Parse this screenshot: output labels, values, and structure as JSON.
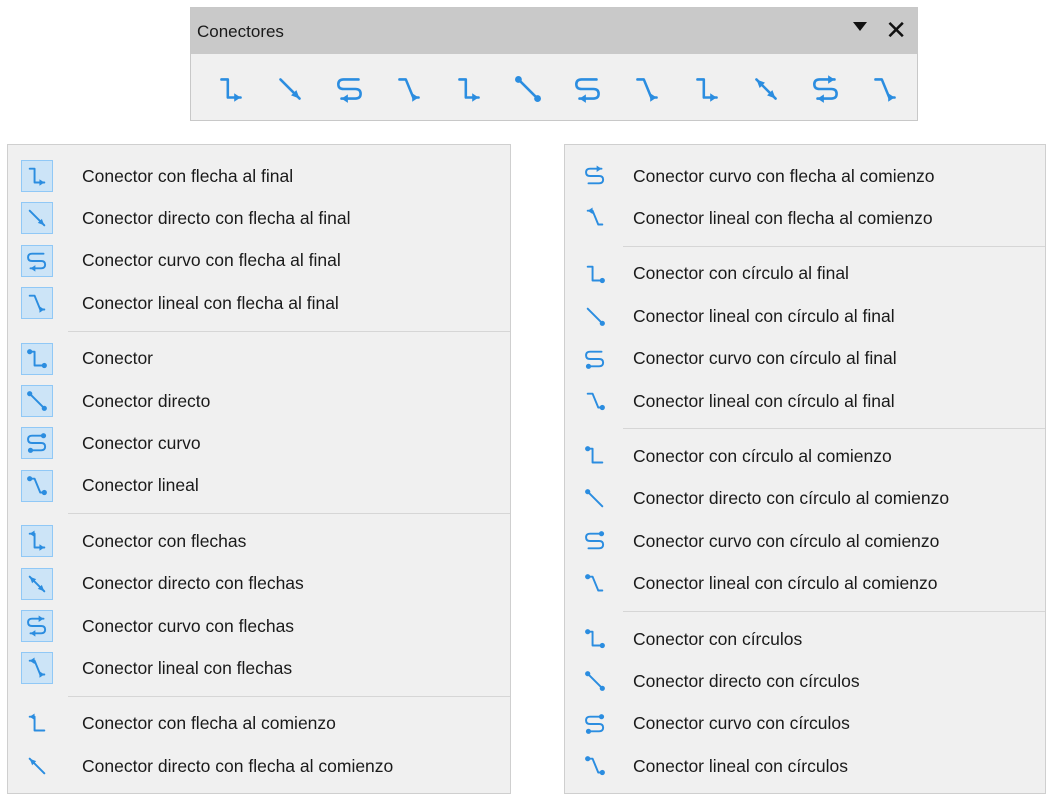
{
  "toolbar": {
    "title": "Conectores",
    "icons": [
      "connector-ends-arrow-icon",
      "straight-connector-ends-arrow-icon",
      "curved-connector-ends-arrow-icon",
      "line-connector-ends-arrow-icon",
      "connector-icon",
      "straight-connector-icon",
      "curved-connector-icon",
      "line-connector-icon",
      "connector-ends-arrow-icon",
      "straight-connector-arrows-icon",
      "curved-connector-arrows-icon",
      "line-connector-arrows-icon"
    ]
  },
  "left_menu": {
    "groups": [
      [
        {
          "label": "Conector con flecha al final",
          "icon": "elbow",
          "ends": "end-arrow",
          "checked": true
        },
        {
          "label": "Conector directo con flecha al final",
          "icon": "straight",
          "ends": "end-arrow",
          "checked": true
        },
        {
          "label": "Conector curvo con flecha al final",
          "icon": "curved",
          "ends": "end-arrow",
          "checked": true
        },
        {
          "label": "Conector lineal con flecha al final",
          "icon": "lineal",
          "ends": "end-arrow",
          "checked": true
        }
      ],
      [
        {
          "label": "Conector",
          "icon": "elbow",
          "ends": "plain",
          "checked": true
        },
        {
          "label": "Conector directo",
          "icon": "straight",
          "ends": "plain",
          "checked": true
        },
        {
          "label": "Conector curvo",
          "icon": "curved",
          "ends": "plain",
          "checked": true
        },
        {
          "label": "Conector lineal",
          "icon": "lineal",
          "ends": "plain",
          "checked": true
        }
      ],
      [
        {
          "label": "Conector con flechas",
          "icon": "elbow",
          "ends": "arrows",
          "checked": true
        },
        {
          "label": "Conector directo con flechas",
          "icon": "straight",
          "ends": "arrows",
          "checked": true
        },
        {
          "label": "Conector curvo con flechas",
          "icon": "curved",
          "ends": "arrows",
          "checked": true
        },
        {
          "label": "Conector lineal con flechas",
          "icon": "lineal",
          "ends": "arrows",
          "checked": true
        }
      ],
      [
        {
          "label": "Conector con flecha al comienzo",
          "icon": "elbow",
          "ends": "start-arrow",
          "checked": false
        },
        {
          "label": "Conector directo con flecha al comienzo",
          "icon": "straight",
          "ends": "start-arrow",
          "checked": false
        }
      ]
    ]
  },
  "right_menu": {
    "groups": [
      [
        {
          "label": "Conector curvo con flecha al comienzo",
          "icon": "curved",
          "ends": "start-arrow",
          "checked": false
        },
        {
          "label": "Conector lineal con flecha al comienzo",
          "icon": "lineal",
          "ends": "start-arrow",
          "checked": false
        }
      ],
      [
        {
          "label": "Conector con círculo al final",
          "icon": "elbow",
          "ends": "end-circle",
          "checked": false
        },
        {
          "label": "Conector lineal con círculo al final",
          "icon": "straight",
          "ends": "end-circle",
          "checked": false
        },
        {
          "label": "Conector curvo con círculo al final",
          "icon": "curved",
          "ends": "end-circle",
          "checked": false
        },
        {
          "label": "Conector lineal con círculo al final",
          "icon": "lineal",
          "ends": "end-circle",
          "checked": false
        }
      ],
      [
        {
          "label": "Conector con círculo al comienzo",
          "icon": "elbow",
          "ends": "start-circle",
          "checked": false
        },
        {
          "label": "Conector directo con círculo al comienzo",
          "icon": "straight",
          "ends": "start-circle",
          "checked": false
        },
        {
          "label": "Conector curvo con círculo al comienzo",
          "icon": "curved",
          "ends": "start-circle",
          "checked": false
        },
        {
          "label": "Conector lineal con círculo al comienzo",
          "icon": "lineal",
          "ends": "start-circle",
          "checked": false
        }
      ],
      [
        {
          "label": "Conector con círculos",
          "icon": "elbow",
          "ends": "circles",
          "checked": false
        },
        {
          "label": "Conector directo con círculos",
          "icon": "straight",
          "ends": "circles",
          "checked": false
        },
        {
          "label": "Conector curvo con círculos",
          "icon": "curved",
          "ends": "circles",
          "checked": false
        },
        {
          "label": "Conector lineal con círculos",
          "icon": "lineal",
          "ends": "circles",
          "checked": false
        }
      ]
    ]
  },
  "colors": {
    "icon": "#2b8de0",
    "checked_bg": "#cce4f7",
    "checked_border": "#90c8f6",
    "panel_bg": "#f0f0f0",
    "title_bg": "#c9c9c9"
  }
}
